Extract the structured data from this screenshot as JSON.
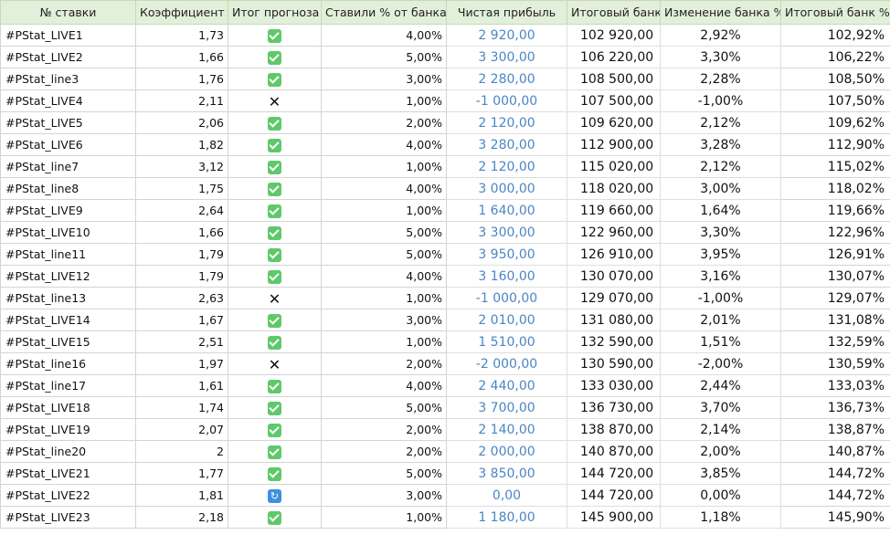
{
  "headers": {
    "bet": "№ ставки",
    "coef": "Коэффициент",
    "result": "Итог прогноза",
    "stake": "Ставили % от банка",
    "profit": "Чистая прибыль",
    "bank": "Итоговый банк",
    "change": "Изменение банка %",
    "bank_pct": "Итоговый банк %"
  },
  "result_icons": {
    "win": "check-box-icon",
    "loss": "cross-icon",
    "refund": "refund-arrows-icon"
  },
  "colors": {
    "header_bg": "#e2efda",
    "profit_text": "#4a86c5",
    "win_icon": "#5fc96a",
    "refund_icon": "#3d8fe0"
  },
  "rows": [
    {
      "bet": "#PStat_LIVE1",
      "coef": "1,73",
      "result": "win",
      "stake": "4,00%",
      "profit": "2 920,00",
      "bank": "102 920,00",
      "change": "2,92%",
      "bank_pct": "102,92%"
    },
    {
      "bet": "#PStat_LIVE2",
      "coef": "1,66",
      "result": "win",
      "stake": "5,00%",
      "profit": "3 300,00",
      "bank": "106 220,00",
      "change": "3,30%",
      "bank_pct": "106,22%"
    },
    {
      "bet": "#PStat_line3",
      "coef": "1,76",
      "result": "win",
      "stake": "3,00%",
      "profit": "2 280,00",
      "bank": "108 500,00",
      "change": "2,28%",
      "bank_pct": "108,50%"
    },
    {
      "bet": "#PStat_LIVE4",
      "coef": "2,11",
      "result": "loss",
      "stake": "1,00%",
      "profit": "-1 000,00",
      "bank": "107 500,00",
      "change": "-1,00%",
      "bank_pct": "107,50%"
    },
    {
      "bet": "#PStat_LIVE5",
      "coef": "2,06",
      "result": "win",
      "stake": "2,00%",
      "profit": "2 120,00",
      "bank": "109 620,00",
      "change": "2,12%",
      "bank_pct": "109,62%"
    },
    {
      "bet": "#PStat_LIVE6",
      "coef": "1,82",
      "result": "win",
      "stake": "4,00%",
      "profit": "3 280,00",
      "bank": "112 900,00",
      "change": "3,28%",
      "bank_pct": "112,90%"
    },
    {
      "bet": "#PStat_line7",
      "coef": "3,12",
      "result": "win",
      "stake": "1,00%",
      "profit": "2 120,00",
      "bank": "115 020,00",
      "change": "2,12%",
      "bank_pct": "115,02%"
    },
    {
      "bet": "#PStat_line8",
      "coef": "1,75",
      "result": "win",
      "stake": "4,00%",
      "profit": "3 000,00",
      "bank": "118 020,00",
      "change": "3,00%",
      "bank_pct": "118,02%"
    },
    {
      "bet": "#PStat_LIVE9",
      "coef": "2,64",
      "result": "win",
      "stake": "1,00%",
      "profit": "1 640,00",
      "bank": "119 660,00",
      "change": "1,64%",
      "bank_pct": "119,66%"
    },
    {
      "bet": "#PStat_LIVE10",
      "coef": "1,66",
      "result": "win",
      "stake": "5,00%",
      "profit": "3 300,00",
      "bank": "122 960,00",
      "change": "3,30%",
      "bank_pct": "122,96%"
    },
    {
      "bet": "#PStat_line11",
      "coef": "1,79",
      "result": "win",
      "stake": "5,00%",
      "profit": "3 950,00",
      "bank": "126 910,00",
      "change": "3,95%",
      "bank_pct": "126,91%"
    },
    {
      "bet": "#PStat_LIVE12",
      "coef": "1,79",
      "result": "win",
      "stake": "4,00%",
      "profit": "3 160,00",
      "bank": "130 070,00",
      "change": "3,16%",
      "bank_pct": "130,07%"
    },
    {
      "bet": "#PStat_line13",
      "coef": "2,63",
      "result": "loss",
      "stake": "1,00%",
      "profit": "-1 000,00",
      "bank": "129 070,00",
      "change": "-1,00%",
      "bank_pct": "129,07%"
    },
    {
      "bet": "#PStat_LIVE14",
      "coef": "1,67",
      "result": "win",
      "stake": "3,00%",
      "profit": "2 010,00",
      "bank": "131 080,00",
      "change": "2,01%",
      "bank_pct": "131,08%"
    },
    {
      "bet": "#PStat_LIVE15",
      "coef": "2,51",
      "result": "win",
      "stake": "1,00%",
      "profit": "1 510,00",
      "bank": "132 590,00",
      "change": "1,51%",
      "bank_pct": "132,59%"
    },
    {
      "bet": "#PStat_line16",
      "coef": "1,97",
      "result": "loss",
      "stake": "2,00%",
      "profit": "-2 000,00",
      "bank": "130 590,00",
      "change": "-2,00%",
      "bank_pct": "130,59%"
    },
    {
      "bet": "#PStat_line17",
      "coef": "1,61",
      "result": "win",
      "stake": "4,00%",
      "profit": "2 440,00",
      "bank": "133 030,00",
      "change": "2,44%",
      "bank_pct": "133,03%"
    },
    {
      "bet": "#PStat_LIVE18",
      "coef": "1,74",
      "result": "win",
      "stake": "5,00%",
      "profit": "3 700,00",
      "bank": "136 730,00",
      "change": "3,70%",
      "bank_pct": "136,73%"
    },
    {
      "bet": "#PStat_LIVE19",
      "coef": "2,07",
      "result": "win",
      "stake": "2,00%",
      "profit": "2 140,00",
      "bank": "138 870,00",
      "change": "2,14%",
      "bank_pct": "138,87%"
    },
    {
      "bet": "#PStat_line20",
      "coef": "2",
      "result": "win",
      "stake": "2,00%",
      "profit": "2 000,00",
      "bank": "140 870,00",
      "change": "2,00%",
      "bank_pct": "140,87%"
    },
    {
      "bet": "#PStat_LIVE21",
      "coef": "1,77",
      "result": "win",
      "stake": "5,00%",
      "profit": "3 850,00",
      "bank": "144 720,00",
      "change": "3,85%",
      "bank_pct": "144,72%"
    },
    {
      "bet": "#PStat_LIVE22",
      "coef": "1,81",
      "result": "refund",
      "stake": "3,00%",
      "profit": "0,00",
      "bank": "144 720,00",
      "change": "0,00%",
      "bank_pct": "144,72%"
    },
    {
      "bet": "#PStat_LIVE23",
      "coef": "2,18",
      "result": "win",
      "stake": "1,00%",
      "profit": "1 180,00",
      "bank": "145 900,00",
      "change": "1,18%",
      "bank_pct": "145,90%"
    }
  ]
}
